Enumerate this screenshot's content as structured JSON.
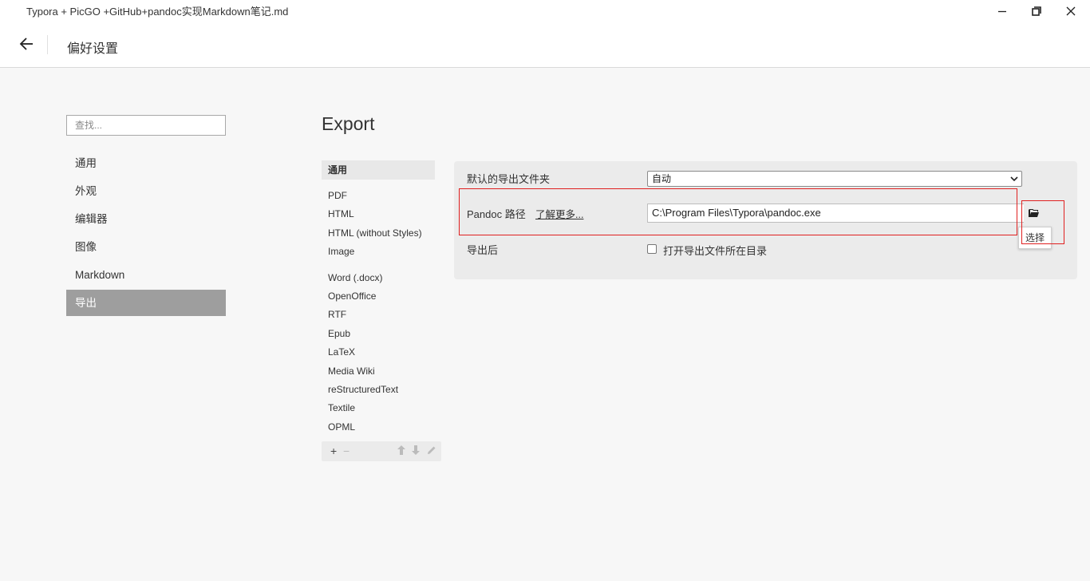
{
  "window": {
    "title": "Typora + PicGO +GitHub+pandoc实现Markdown笔记.md",
    "minimize_icon": "minimize-icon",
    "maximize_icon": "restore-icon",
    "close_icon": "close-icon"
  },
  "header": {
    "back_icon": "arrow-left-icon",
    "title": "偏好设置"
  },
  "sidebar": {
    "search_placeholder": "查找...",
    "items": [
      {
        "label": "通用",
        "active": false
      },
      {
        "label": "外观",
        "active": false
      },
      {
        "label": "编辑器",
        "active": false
      },
      {
        "label": "图像",
        "active": false
      },
      {
        "label": "Markdown",
        "active": false
      },
      {
        "label": "导出",
        "active": true
      }
    ]
  },
  "export": {
    "title": "Export",
    "formats_general": "通用",
    "formats_group1": [
      "PDF",
      "HTML",
      "HTML (without Styles)",
      "Image"
    ],
    "formats_group2": [
      "Word (.docx)",
      "OpenOffice",
      "RTF",
      "Epub",
      "LaTeX",
      "Media Wiki",
      "reStructuredText",
      "Textile",
      "OPML"
    ],
    "toolbar": {
      "add": "+",
      "remove": "−",
      "up_icon": "arrow-up-icon",
      "down_icon": "arrow-down-icon",
      "edit_icon": "pencil-icon"
    }
  },
  "settings": {
    "default_folder_label": "默认的导出文件夹",
    "default_folder_value": "自动",
    "pandoc_label": "Pandoc 路径",
    "learn_more": "了解更多...",
    "pandoc_path": "C:\\Program Files\\Typora\\pandoc.exe",
    "folder_icon": "folder-icon",
    "tooltip": "选择",
    "after_export_label": "导出后",
    "open_folder_label": "打开导出文件所在目录",
    "open_folder_checked": false
  },
  "colors": {
    "accent_active": "#9e9e9e",
    "highlight": "#e02020",
    "panel": "#ebebeb"
  }
}
